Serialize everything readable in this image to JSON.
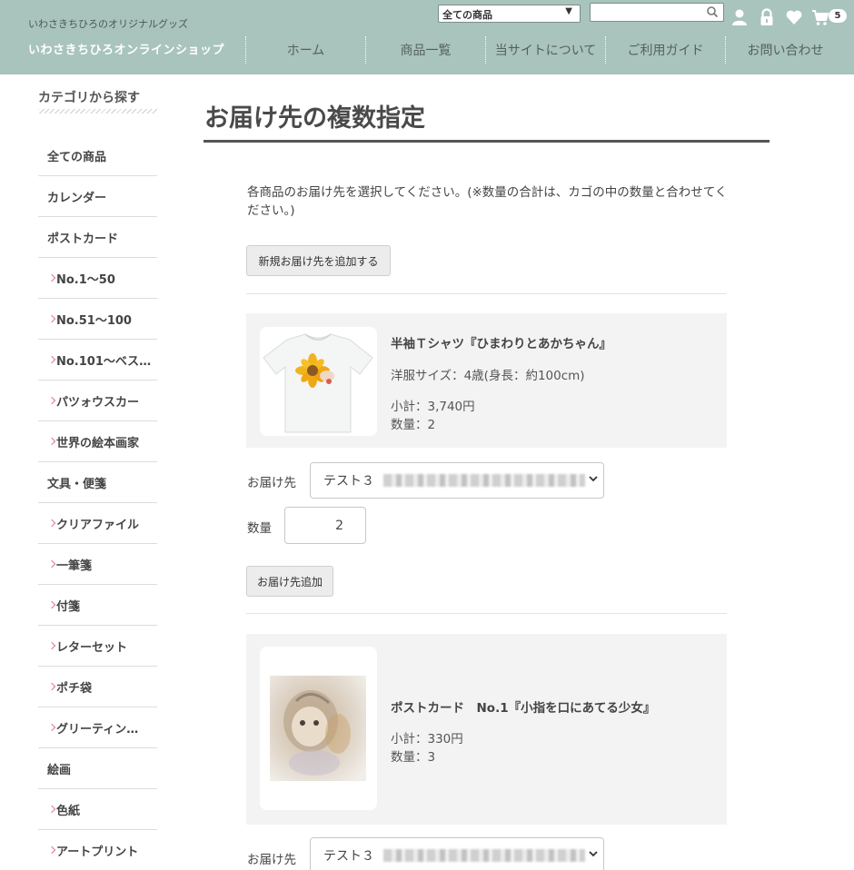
{
  "header": {
    "tagline": "いわさきちひろのオリジナルグッズ",
    "shop_name": "いわさきちひろオンラインショップ",
    "category_select": "全ての商品",
    "search_placeholder": "",
    "cart_count": "5",
    "nav": [
      "ホーム",
      "商品一覧",
      "当サイトについて",
      "ご利用ガイド",
      "お問い合わせ"
    ],
    "brand_color": "#a9c3bd"
  },
  "sidebar": {
    "title": "カテゴリから探す",
    "items": [
      {
        "label": "全ての商品",
        "sub": false
      },
      {
        "label": "カレンダー",
        "sub": false
      },
      {
        "label": "ポストカード",
        "sub": false
      },
      {
        "label": "No.1〜50",
        "sub": true
      },
      {
        "label": "No.51〜100",
        "sub": true
      },
      {
        "label": "No.101〜ベス…",
        "sub": true
      },
      {
        "label": "パツォウスカー",
        "sub": true
      },
      {
        "label": "世界の絵本画家",
        "sub": true
      },
      {
        "label": "文具・便箋",
        "sub": false
      },
      {
        "label": "クリアファイル",
        "sub": true
      },
      {
        "label": "一筆箋",
        "sub": true
      },
      {
        "label": "付箋",
        "sub": true
      },
      {
        "label": "レターセット",
        "sub": true
      },
      {
        "label": "ポチ袋",
        "sub": true
      },
      {
        "label": "グリーティン…",
        "sub": true
      },
      {
        "label": "絵画",
        "sub": false
      },
      {
        "label": "色紙",
        "sub": true
      },
      {
        "label": "アートプリント",
        "sub": true
      }
    ]
  },
  "main": {
    "title": "お届け先の複数指定",
    "intro": "各商品のお届け先を選択してください。(※数量の合計は、カゴの中の数量と合わせてください。)",
    "add_address_button": "新規お届け先を追加する",
    "products": [
      {
        "name": "半袖Ｔシャツ『ひまわりとあかちゃん』",
        "size": "洋服サイズ：4歳(身長：約100cm)",
        "subtotal": "小計：3,740円",
        "quantity": "数量：2",
        "ship_label": "お届け先",
        "ship_value": "テスト３",
        "qty_label": "数量",
        "qty_value": "2",
        "add_ship_button": "お届け先追加"
      },
      {
        "name": "ポストカード　No.1『小指を口にあてる少女』",
        "subtotal": "小計：330円",
        "quantity": "数量：3",
        "ship_label": "お届け先",
        "ship_value": "テスト３"
      }
    ]
  }
}
